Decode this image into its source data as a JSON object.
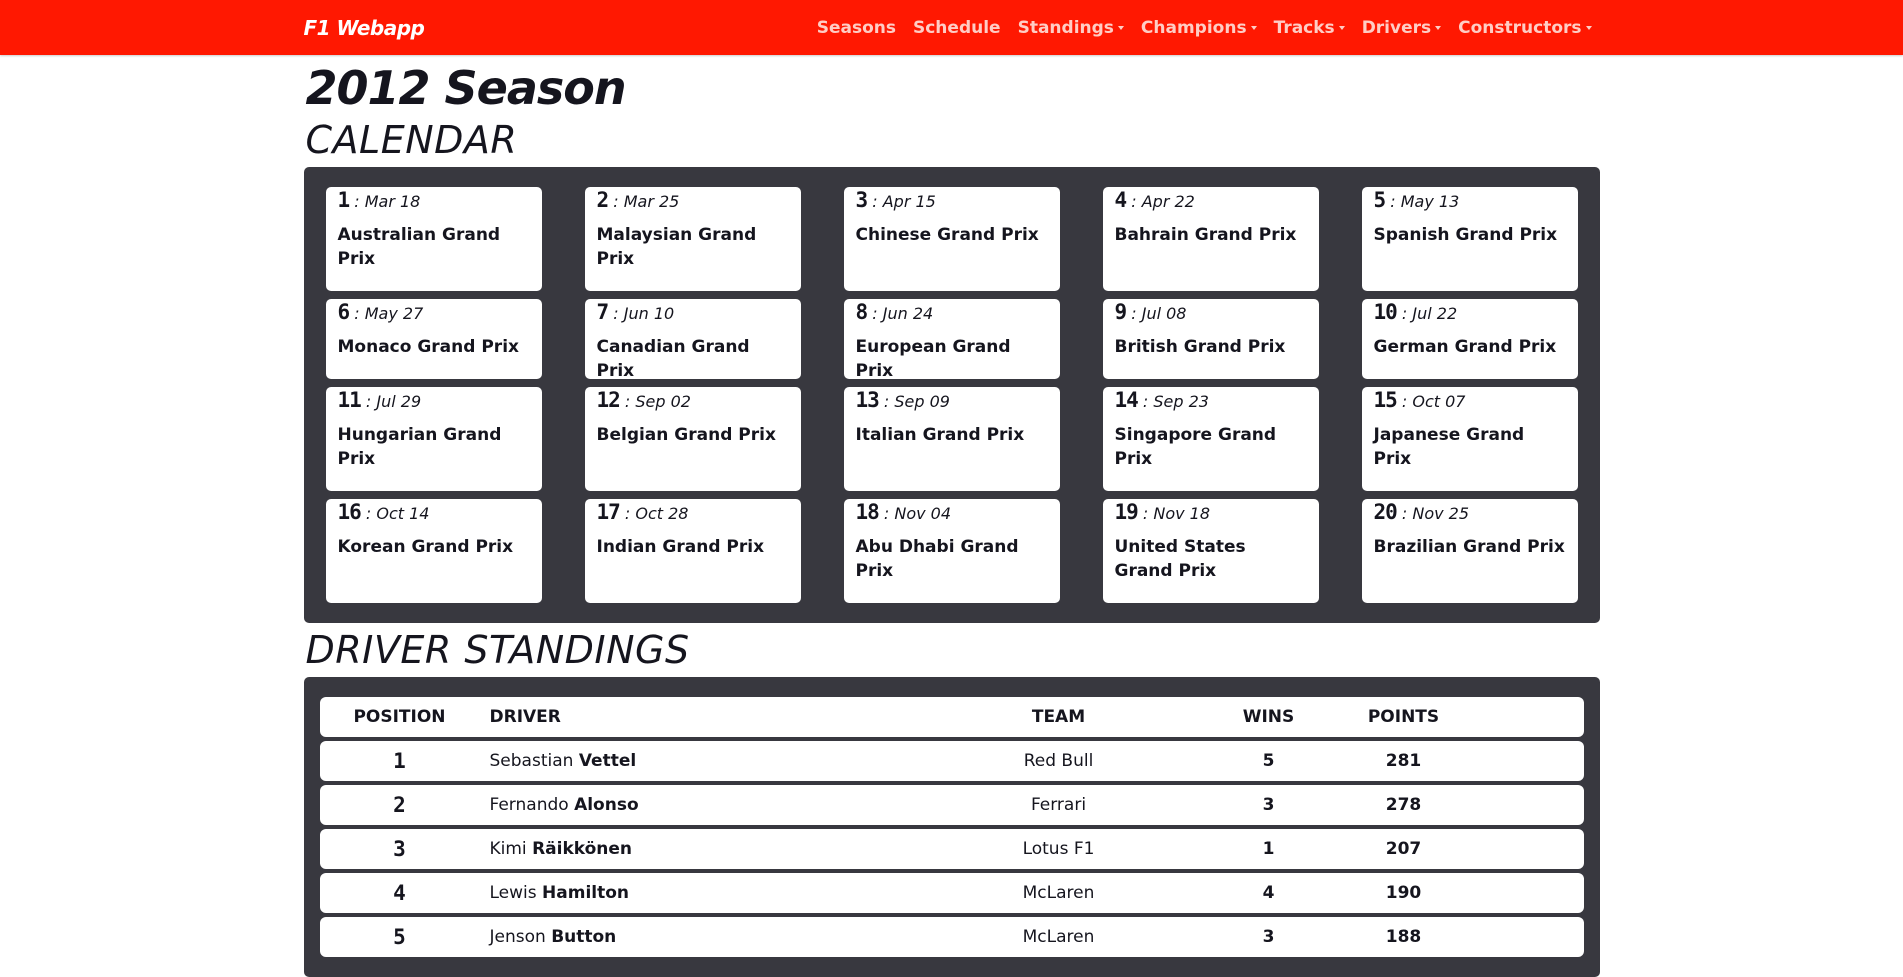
{
  "navbar": {
    "brand": "F1 Webapp",
    "links": [
      {
        "label": "Seasons",
        "dropdown": false
      },
      {
        "label": "Schedule",
        "dropdown": false
      },
      {
        "label": "Standings",
        "dropdown": true
      },
      {
        "label": "Champions",
        "dropdown": true
      },
      {
        "label": "Tracks",
        "dropdown": true
      },
      {
        "label": "Drivers",
        "dropdown": true
      },
      {
        "label": "Constructors",
        "dropdown": true
      }
    ]
  },
  "page": {
    "title": "2012 Season",
    "calendar_title": "CALENDAR",
    "standings_title": "DRIVER STANDINGS"
  },
  "calendar": [
    {
      "round": "1",
      "date": ": Mar 18",
      "name": "Australian Grand Prix"
    },
    {
      "round": "2",
      "date": ": Mar 25",
      "name": "Malaysian Grand Prix"
    },
    {
      "round": "3",
      "date": ": Apr 15",
      "name": "Chinese Grand Prix"
    },
    {
      "round": "4",
      "date": ": Apr 22",
      "name": "Bahrain Grand Prix"
    },
    {
      "round": "5",
      "date": ": May 13",
      "name": "Spanish Grand Prix"
    },
    {
      "round": "6",
      "date": ": May 27",
      "name": "Monaco Grand Prix"
    },
    {
      "round": "7",
      "date": ": Jun 10",
      "name": "Canadian Grand Prix"
    },
    {
      "round": "8",
      "date": ": Jun 24",
      "name": "European Grand Prix"
    },
    {
      "round": "9",
      "date": ": Jul 08",
      "name": "British Grand Prix"
    },
    {
      "round": "10",
      "date": ": Jul 22",
      "name": "German Grand Prix"
    },
    {
      "round": "11",
      "date": ": Jul 29",
      "name": "Hungarian Grand Prix"
    },
    {
      "round": "12",
      "date": ": Sep 02",
      "name": "Belgian Grand Prix"
    },
    {
      "round": "13",
      "date": ": Sep 09",
      "name": "Italian Grand Prix"
    },
    {
      "round": "14",
      "date": ": Sep 23",
      "name": "Singapore Grand Prix"
    },
    {
      "round": "15",
      "date": ": Oct 07",
      "name": "Japanese Grand Prix"
    },
    {
      "round": "16",
      "date": ": Oct 14",
      "name": "Korean Grand Prix"
    },
    {
      "round": "17",
      "date": ": Oct 28",
      "name": "Indian Grand Prix"
    },
    {
      "round": "18",
      "date": ": Nov 04",
      "name": "Abu Dhabi Grand Prix"
    },
    {
      "round": "19",
      "date": ": Nov 18",
      "name": "United States Grand Prix"
    },
    {
      "round": "20",
      "date": ": Nov 25",
      "name": "Brazilian Grand Prix"
    }
  ],
  "standings": {
    "headers": {
      "position": "POSITION",
      "driver": "DRIVER",
      "team": "TEAM",
      "wins": "WINS",
      "points": "POINTS"
    },
    "rows": [
      {
        "position": "1",
        "first": "Sebastian",
        "last": "Vettel",
        "team": "Red Bull",
        "wins": "5",
        "points": "281"
      },
      {
        "position": "2",
        "first": "Fernando",
        "last": "Alonso",
        "team": "Ferrari",
        "wins": "3",
        "points": "278"
      },
      {
        "position": "3",
        "first": "Kimi",
        "last": "Räikkönen",
        "team": "Lotus F1",
        "wins": "1",
        "points": "207"
      },
      {
        "position": "4",
        "first": "Lewis",
        "last": "Hamilton",
        "team": "McLaren",
        "wins": "4",
        "points": "190"
      },
      {
        "position": "5",
        "first": "Jenson",
        "last": "Button",
        "team": "McLaren",
        "wins": "3",
        "points": "188"
      }
    ]
  },
  "colors": {
    "brand": "#ff1801",
    "panel": "#38383f",
    "text": "#15151e"
  }
}
